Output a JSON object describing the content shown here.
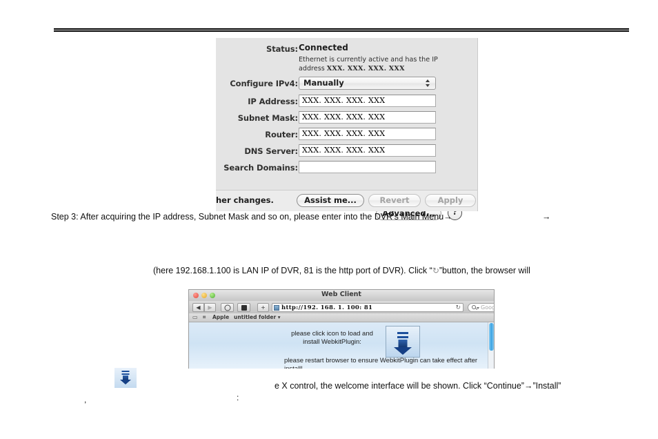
{
  "header": {
    "rule": "double-horizontal-rule"
  },
  "network_pane": {
    "rows": [
      {
        "label": "Status:",
        "type": "status",
        "value": "Connected",
        "description_prefix": "Ethernet is currently active and has the IP address ",
        "description_value": "XXX. XXX. XXX. XXX"
      },
      {
        "label": "Configure IPv4:",
        "type": "select",
        "value": "Manually"
      },
      {
        "label": "IP Address:",
        "type": "field",
        "value": "XXX. XXX. XXX. XXX"
      },
      {
        "label": "Subnet Mask:",
        "type": "field",
        "value": "XXX. XXX. XXX. XXX"
      },
      {
        "label": "Router:",
        "type": "field",
        "value": "XXX. XXX. XXX. XXX"
      },
      {
        "label": "DNS Server:",
        "type": "field",
        "value": " XXX. XXX. XXX. XXX"
      },
      {
        "label": "Search Domains:",
        "type": "field",
        "value": ""
      }
    ],
    "advanced_button": "Advanced...",
    "help_button": "?",
    "footer_note": "her changes.",
    "assist_button": "Assist me...",
    "revert_button": "Revert",
    "apply_button": "Apply"
  },
  "prose": {
    "step3": "Step 3: After acquiring the IP address, Subnet Mask and so on, please enter into the DVR's Main Menu→",
    "step3_trailing_arrow": "→",
    "here_line_before": "(here 192.168.1.100 is LAN IP of DVR, 81 is the http port of DVR). Click “",
    "here_line_glyph": "↻",
    "here_line_after": "”button, the browser will",
    "ex_line": "e X control, the welcome interface will be shown. Click “Continue”→”Install”",
    "stray_comma": ",",
    "stray_colon": ":"
  },
  "browser": {
    "title": "Web Client",
    "url": "http://192. 168. 1. 100: 81",
    "reload_glyph": "↻",
    "search_placeholder": "Google",
    "back_label": "◀",
    "forward_label": "▶",
    "bookmarks_bar": {
      "reader": "▭",
      "grid": "⌗",
      "apple": "Apple",
      "folder": "untitled folder ▾"
    },
    "page": {
      "message_1": "please click icon to load and install WebkitPlugin:",
      "message_2": "please restart browser to ensure WebkitPlugin can take effect after install!",
      "download_icon": "webkit-plugin-download-icon"
    }
  },
  "standalone_icon": {
    "name": "download-plugin-icon"
  }
}
